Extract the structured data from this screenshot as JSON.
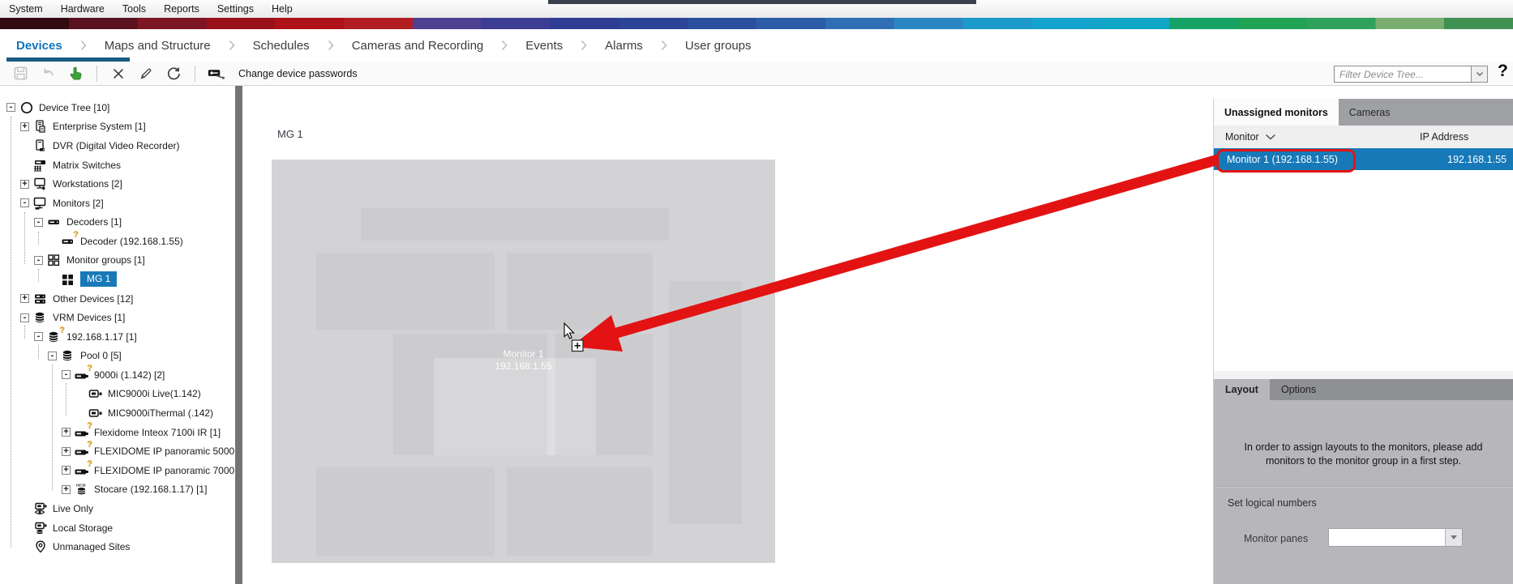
{
  "window": {
    "menu_items": [
      "System",
      "Hardware",
      "Tools",
      "Reports",
      "Settings",
      "Help"
    ]
  },
  "brand_stripe_colors": [
    "#330a12",
    "#5a1120",
    "#7c1622",
    "#99121a",
    "#ae1118",
    "#b21d22",
    "#4d3f91",
    "#3d3d93",
    "#2f3c93",
    "#2c4398",
    "#2b4f9f",
    "#2c5ca8",
    "#2f6fb4",
    "#2b87c1",
    "#1c9ac9",
    "#13a3cc",
    "#0fa7c5",
    "#16a264",
    "#20a355",
    "#2ea15c",
    "#79ae6f",
    "#419053"
  ],
  "nav": {
    "tabs": [
      {
        "label": "Devices",
        "active": true
      },
      {
        "label": "Maps and Structure"
      },
      {
        "label": "Schedules"
      },
      {
        "label": "Cameras and Recording"
      },
      {
        "label": "Events"
      },
      {
        "label": "Alarms"
      },
      {
        "label": "User groups"
      }
    ]
  },
  "toolbar": {
    "icons": [
      {
        "name": "save-icon",
        "enabled": false
      },
      {
        "name": "undo-icon",
        "enabled": false
      },
      {
        "name": "activate-configuration-icon",
        "enabled": true
      },
      {
        "sep": true
      },
      {
        "name": "delete-icon",
        "enabled": true
      },
      {
        "name": "edit-icon",
        "enabled": true
      },
      {
        "name": "refresh-icon",
        "enabled": true
      },
      {
        "sep": true
      },
      {
        "name": "change-password-icon",
        "enabled": true
      }
    ],
    "change_passwords_label": "Change device passwords",
    "filter_placeholder": "Filter Device Tree...",
    "help_label": "?"
  },
  "device_tree": {
    "items": [
      {
        "label": "Device Tree [10]",
        "level": 0,
        "expander": "minus",
        "icon": "device-tree-icon"
      },
      {
        "label": "Enterprise System [1]",
        "level": 1,
        "expander": "plus",
        "icon": "enterprise-system-icon"
      },
      {
        "label": "DVR (Digital Video Recorder)",
        "level": 1,
        "expander": "",
        "icon": "dvr-icon"
      },
      {
        "label": "Matrix Switches",
        "level": 1,
        "expander": "",
        "icon": "matrix-switch-icon"
      },
      {
        "label": "Workstations [2]",
        "level": 1,
        "expander": "plus",
        "icon": "workstation-icon"
      },
      {
        "label": "Monitors [2]",
        "level": 1,
        "expander": "minus",
        "icon": "monitor-icon"
      },
      {
        "label": "Decoders [1]",
        "level": 2,
        "expander": "minus",
        "icon": "decoder-icon"
      },
      {
        "label": "Decoder (192.168.1.55)",
        "level": 3,
        "expander": "",
        "icon": "decoder-icon",
        "badge": true
      },
      {
        "label": "Monitor groups [1]",
        "level": 2,
        "expander": "minus",
        "icon": "monitor-group-icon"
      },
      {
        "label": "MG 1",
        "level": 3,
        "expander": "",
        "icon": "monitor-group-item-icon",
        "selected": true
      },
      {
        "label": "Other Devices [12]",
        "level": 1,
        "expander": "plus",
        "icon": "other-devices-icon"
      },
      {
        "label": "VRM Devices [1]",
        "level": 1,
        "expander": "minus",
        "icon": "vrm-devices-icon"
      },
      {
        "label": "192.168.1.17 [1]",
        "level": 2,
        "expander": "minus",
        "icon": "vrm-server-icon",
        "badge": true
      },
      {
        "label": "Pool 0 [5]",
        "level": 3,
        "expander": "minus",
        "icon": "pool-icon"
      },
      {
        "label": "9000i (1.142) [2]",
        "level": 4,
        "expander": "minus",
        "icon": "camera-device-icon",
        "badge": true
      },
      {
        "label": "MIC9000i Live(1.142)",
        "level": 5,
        "expander": "",
        "icon": "camera-icon"
      },
      {
        "label": "MIC9000iThermal (.142)",
        "level": 5,
        "expander": "",
        "icon": "camera-icon"
      },
      {
        "label": "Flexidome Inteox 7100i IR [1]",
        "level": 4,
        "expander": "plus",
        "icon": "camera-device-icon",
        "badge": true
      },
      {
        "label": "FLEXIDOME IP panoramic 5000",
        "level": 4,
        "expander": "plus",
        "icon": "camera-device-icon",
        "badge": true
      },
      {
        "label": "FLEXIDOME IP panoramic 7000",
        "level": 4,
        "expander": "plus",
        "icon": "camera-device-icon",
        "badge": true
      },
      {
        "label": "Stocare (192.168.1.17) [1]",
        "level": 4,
        "expander": "plus",
        "icon": "iscsi-storage-icon"
      },
      {
        "label": "Live Only",
        "level": 1,
        "expander": "",
        "icon": "live-only-icon"
      },
      {
        "label": "Local Storage",
        "level": 1,
        "expander": "",
        "icon": "local-storage-icon"
      },
      {
        "label": "Unmanaged Sites",
        "level": 1,
        "expander": "",
        "icon": "unmanaged-sites-icon"
      }
    ]
  },
  "workspace": {
    "group_title": "MG 1",
    "monitor_label": "Monitor 1",
    "monitor_ip": "192.168.1.55"
  },
  "right_panel": {
    "tabs": [
      {
        "label": "Unassigned monitors",
        "active": true
      },
      {
        "label": "Cameras"
      }
    ],
    "columns": [
      "Monitor",
      "IP Address"
    ],
    "rows": [
      {
        "monitor": "Monitor 1 (192.168.1.55)",
        "ip": "192.168.1.55",
        "selected": true
      }
    ],
    "bottom_tabs": [
      {
        "label": "Layout",
        "active": true
      },
      {
        "label": "Options"
      }
    ],
    "message": "In order to assign layouts to the monitors, please add monitors to the monitor group in a first step.",
    "set_logical_numbers_label": "Set logical numbers",
    "monitor_panes_label": "Monitor panes"
  },
  "colors": {
    "selection_blue": "#1779b8",
    "annotation_red": "#e31313",
    "active_tab_blue": "#1173bb",
    "devices_underline": "#185c80"
  }
}
